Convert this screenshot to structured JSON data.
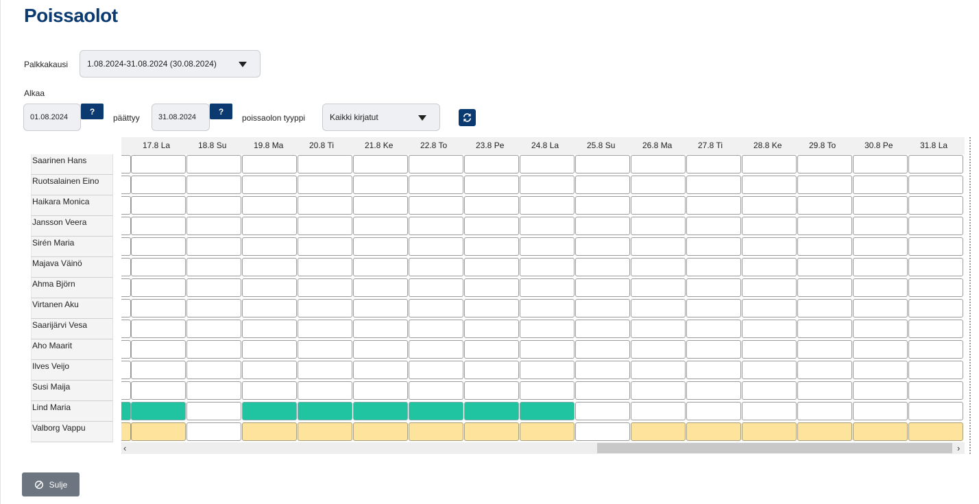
{
  "page": {
    "title": "Poissaolot"
  },
  "filters": {
    "period_label": "Palkkakausi",
    "period_value": "1.08.2024-31.08.2024 (30.08.2024)",
    "start_label": "Alkaa",
    "start_value": "01.08.2024",
    "end_label": "päättyy",
    "end_value": "31.08.2024",
    "help_label": "?",
    "type_label": "poissaolon tyyppi",
    "type_value": "Kaikki kirjatut"
  },
  "grid": {
    "days": [
      "17.8 La",
      "18.8 Su",
      "19.8 Ma",
      "20.8 Ti",
      "21.8 Ke",
      "22.8 To",
      "23.8 Pe",
      "24.8 La",
      "25.8 Su",
      "26.8 Ma",
      "27.8 Ti",
      "28.8 Ke",
      "29.8 To",
      "30.8 Pe",
      "31.8 La"
    ],
    "employees": [
      {
        "name": "Saarinen Hans",
        "cells": "...............",
        "lead": "."
      },
      {
        "name": "Ruotsalainen Eino",
        "cells": "...............",
        "lead": "."
      },
      {
        "name": "Haikara Monica",
        "cells": "...............",
        "lead": "."
      },
      {
        "name": "Jansson Veera",
        "cells": "...............",
        "lead": "."
      },
      {
        "name": "Sirén Maria",
        "cells": "...............",
        "lead": "."
      },
      {
        "name": "Majava Väinö",
        "cells": "...............",
        "lead": "."
      },
      {
        "name": "Ahma Björn",
        "cells": "...............",
        "lead": "."
      },
      {
        "name": "Virtanen Aku",
        "cells": "...............",
        "lead": "."
      },
      {
        "name": "Saarijärvi Vesa",
        "cells": "...............",
        "lead": "."
      },
      {
        "name": "Aho Maarit",
        "cells": "...............",
        "lead": "."
      },
      {
        "name": "Ilves Veijo",
        "cells": "...............",
        "lead": "."
      },
      {
        "name": "Susi Maija",
        "cells": "...............",
        "lead": "."
      },
      {
        "name": "Lind Maria",
        "cells": "G.GGGGGG.......",
        "lead": "G"
      },
      {
        "name": "Valborg Vappu",
        "cells": "Y.YYYYYY.YYYYYY",
        "lead": "Y"
      }
    ],
    "colors": {
      "absence_green": "#21c4a0",
      "absence_yellow": "#fde39c"
    }
  },
  "icons": {
    "refresh": "refresh-icon",
    "close": "ban-icon",
    "dropdown": "caret-down-icon"
  },
  "footer": {
    "close_label": "Sulje"
  },
  "theme": {
    "primary": "#0b3a70",
    "secondary_button": "#6c7580"
  }
}
